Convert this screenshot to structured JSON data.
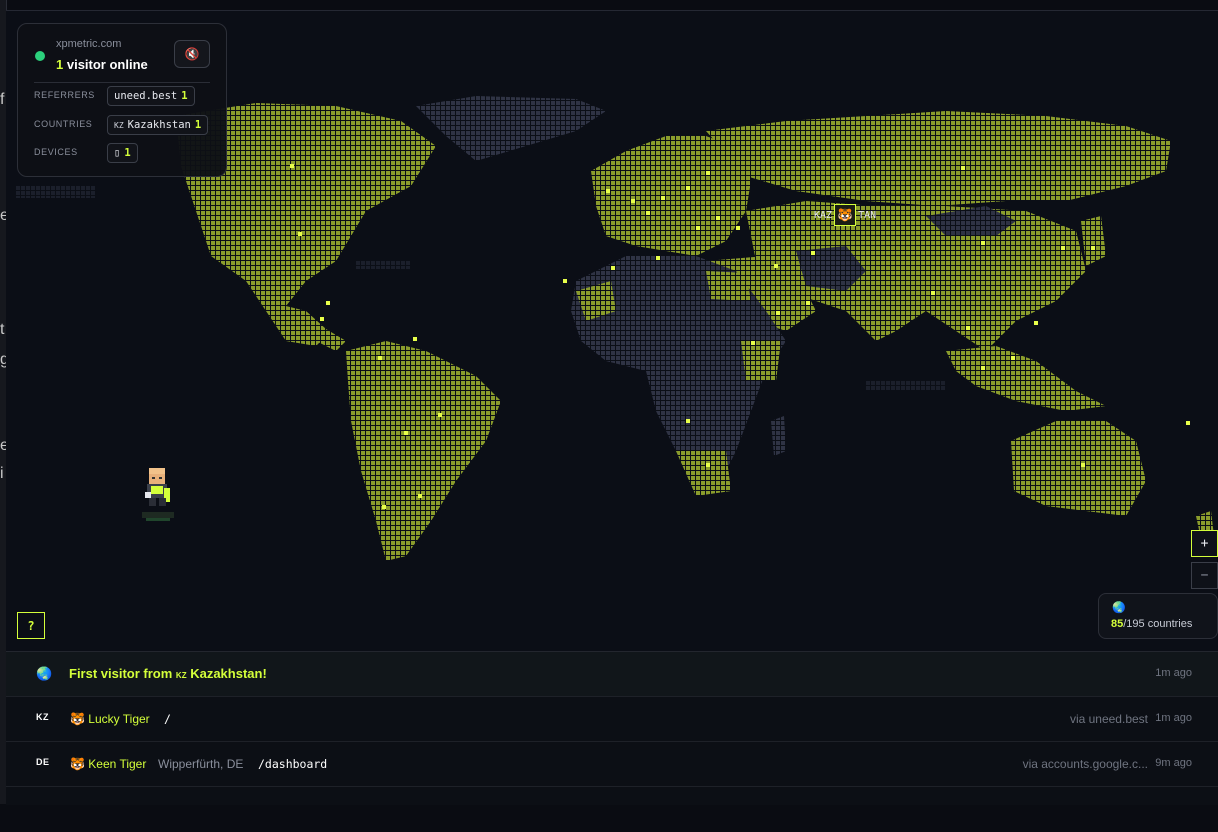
{
  "left_strip_letters": [
    "f",
    "e",
    "t",
    "g",
    "e",
    "i"
  ],
  "stats": {
    "site": "xpmetric.com",
    "visitors_count": "1",
    "visitors_suffix": " visitor online",
    "mute_icon": "🔇",
    "referrers_label": "REFERRERS",
    "referrer_name": "uneed.best",
    "referrer_count": "1",
    "countries_label": "COUNTRIES",
    "country_code": "KZ",
    "country_name": "Kazakhstan",
    "country_count": "1",
    "devices_label": "DEVICES",
    "device_icon": "▯",
    "device_count": "1"
  },
  "map": {
    "highlight_label_left": "KAZ",
    "highlight_icon": "🐯",
    "highlight_label_right": "TAN",
    "colors": {
      "visited": "#8a9c2c",
      "unvisited": "#2f3344",
      "marker": "#e8ff4a",
      "accent": "#d4ff3a"
    }
  },
  "controls": {
    "help": "?",
    "zoom_in": "+",
    "zoom_out": "−",
    "globe_icon": "🌏",
    "countries_visited": "85",
    "countries_total": "/195 countries"
  },
  "feed": {
    "first": {
      "icon": "🌏",
      "prefix": "First visitor from ",
      "cc": "KZ",
      "country": " Kazakhstan!",
      "ago": "1m ago"
    },
    "rows": [
      {
        "flag": "KZ",
        "icon": "🐯",
        "name": "Lucky Tiger",
        "location": "",
        "path": "/",
        "via": "via uneed.best",
        "ago": "1m ago"
      },
      {
        "flag": "DE",
        "icon": "🐯",
        "name": "Keen Tiger",
        "location": "Wipperfürth, DE",
        "path": "/dashboard",
        "via": "via accounts.google.c...",
        "ago": "9m ago"
      }
    ]
  }
}
